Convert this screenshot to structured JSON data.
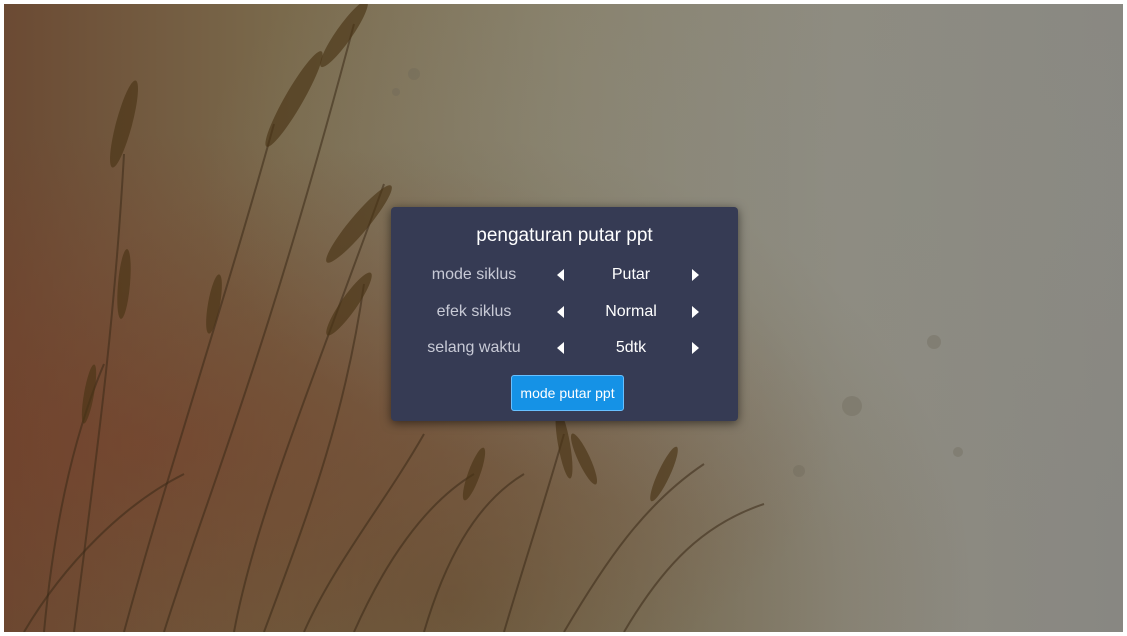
{
  "dialog": {
    "title": "pengaturan putar ppt",
    "settings": [
      {
        "label": "mode siklus",
        "value": "Putar",
        "prev_icon": "caret-left-icon",
        "next_icon": "caret-right-icon"
      },
      {
        "label": "efek siklus",
        "value": "Normal",
        "prev_icon": "caret-left-icon",
        "next_icon": "caret-right-icon"
      },
      {
        "label": "selang waktu",
        "value": "5dtk",
        "prev_icon": "caret-left-icon",
        "next_icon": "caret-right-icon"
      }
    ],
    "play_button_label": "mode putar ppt"
  },
  "colors": {
    "panel_bg": "#363b54",
    "button_bg": "#1592e6",
    "label_text": "#c8cad6",
    "value_text": "#ffffff"
  }
}
